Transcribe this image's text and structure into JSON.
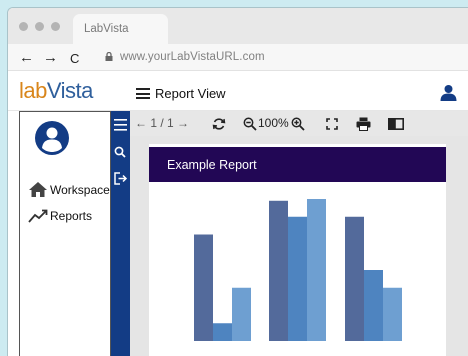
{
  "browser": {
    "tab_title": "LabVista",
    "url": "www.yourLabVistaURL.com",
    "back_glyph": "←",
    "forward_glyph": "→",
    "reload_glyph": "C"
  },
  "app": {
    "logo_part1": "lab",
    "logo_part2": "Vista",
    "title": "Report View"
  },
  "sidebar": {
    "items": [
      {
        "label": "Workspace",
        "icon": "home-icon"
      },
      {
        "label": "Reports",
        "icon": "trend-icon"
      }
    ]
  },
  "toolstrip": [
    "menu-icon",
    "search-icon",
    "logout-icon"
  ],
  "viewer": {
    "pager": "← 1 / 1 →",
    "zoom": "100%",
    "tools": [
      "refresh-icon",
      "zoom-out-icon",
      "zoom-in-icon",
      "fullscreen-icon",
      "print-icon",
      "book-icon"
    ]
  },
  "report": {
    "title": "Example Report"
  },
  "chart_data": {
    "type": "bar",
    "categories": [
      "",
      "",
      ""
    ],
    "series": [
      {
        "values": [
          60,
          79,
          70
        ],
        "color": "#536a9b"
      },
      {
        "values": [
          10,
          70,
          40
        ],
        "color": "#4e84c0"
      },
      {
        "values": [
          30,
          80,
          30
        ],
        "color": "#6e9fd1"
      }
    ],
    "ylim": [
      0,
      80
    ],
    "grid": false
  },
  "colors": {
    "background": "#cdebf1",
    "toolstrip": "#133c85",
    "report_header": "#220755",
    "logo_orange": "#d9861b",
    "logo_blue": "#2f5f9c"
  }
}
